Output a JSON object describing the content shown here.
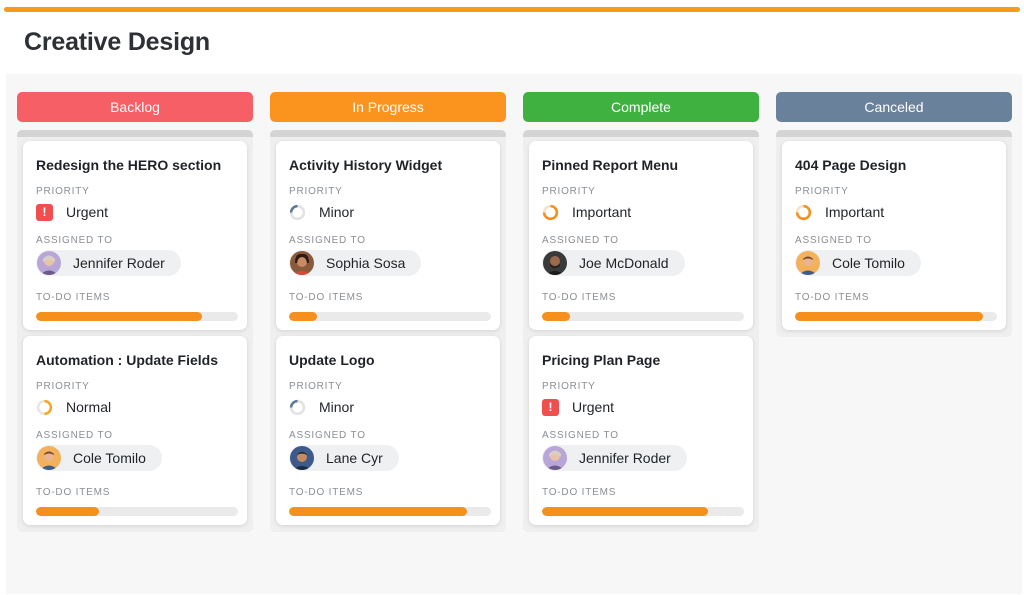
{
  "page": {
    "title": "Creative Design"
  },
  "colors": {
    "accent": "#f79a1c",
    "backlog": "#f75f66",
    "in_progress": "#fb941f",
    "complete": "#3eb140",
    "canceled": "#6a819c",
    "urgent": "#ef4f4f",
    "progress_fill": "#f5901c"
  },
  "labels": {
    "priority": "PRIORITY",
    "assigned_to": "ASSIGNED TO",
    "todo_items": "TO-DO ITEMS"
  },
  "columns": [
    {
      "title": "Backlog",
      "cards": [
        {
          "title": "Redesign the HERO section",
          "priority": "Urgent",
          "priority_icon": "exclamation-icon",
          "assignee": "Jennifer Roder",
          "todo_progress": 0.82
        },
        {
          "title": "Automation : Update Fields",
          "priority": "Normal",
          "priority_icon": "half-circle-icon",
          "assignee": "Cole Tomilo",
          "todo_progress": 0.31
        }
      ]
    },
    {
      "title": "In Progress",
      "cards": [
        {
          "title": "Activity History Widget",
          "priority": "Minor",
          "priority_icon": "quarter-circle-icon",
          "assignee": "Sophia Sosa",
          "todo_progress": 0.14
        },
        {
          "title": "Update Logo",
          "priority": "Minor",
          "priority_icon": "quarter-circle-icon",
          "assignee": "Lane Cyr",
          "todo_progress": 0.88
        }
      ]
    },
    {
      "title": "Complete",
      "cards": [
        {
          "title": "Pinned Report Menu",
          "priority": "Important",
          "priority_icon": "three-quarter-circle-icon",
          "assignee": "Joe McDonald",
          "todo_progress": 0.14
        },
        {
          "title": "Pricing Plan Page",
          "priority": "Urgent",
          "priority_icon": "exclamation-icon",
          "assignee": "Jennifer Roder",
          "todo_progress": 0.82
        }
      ]
    },
    {
      "title": "Canceled",
      "cards": [
        {
          "title": "404 Page Design",
          "priority": "Important",
          "priority_icon": "three-quarter-circle-icon",
          "assignee": "Cole Tomilo",
          "todo_progress": 0.93
        }
      ]
    }
  ]
}
